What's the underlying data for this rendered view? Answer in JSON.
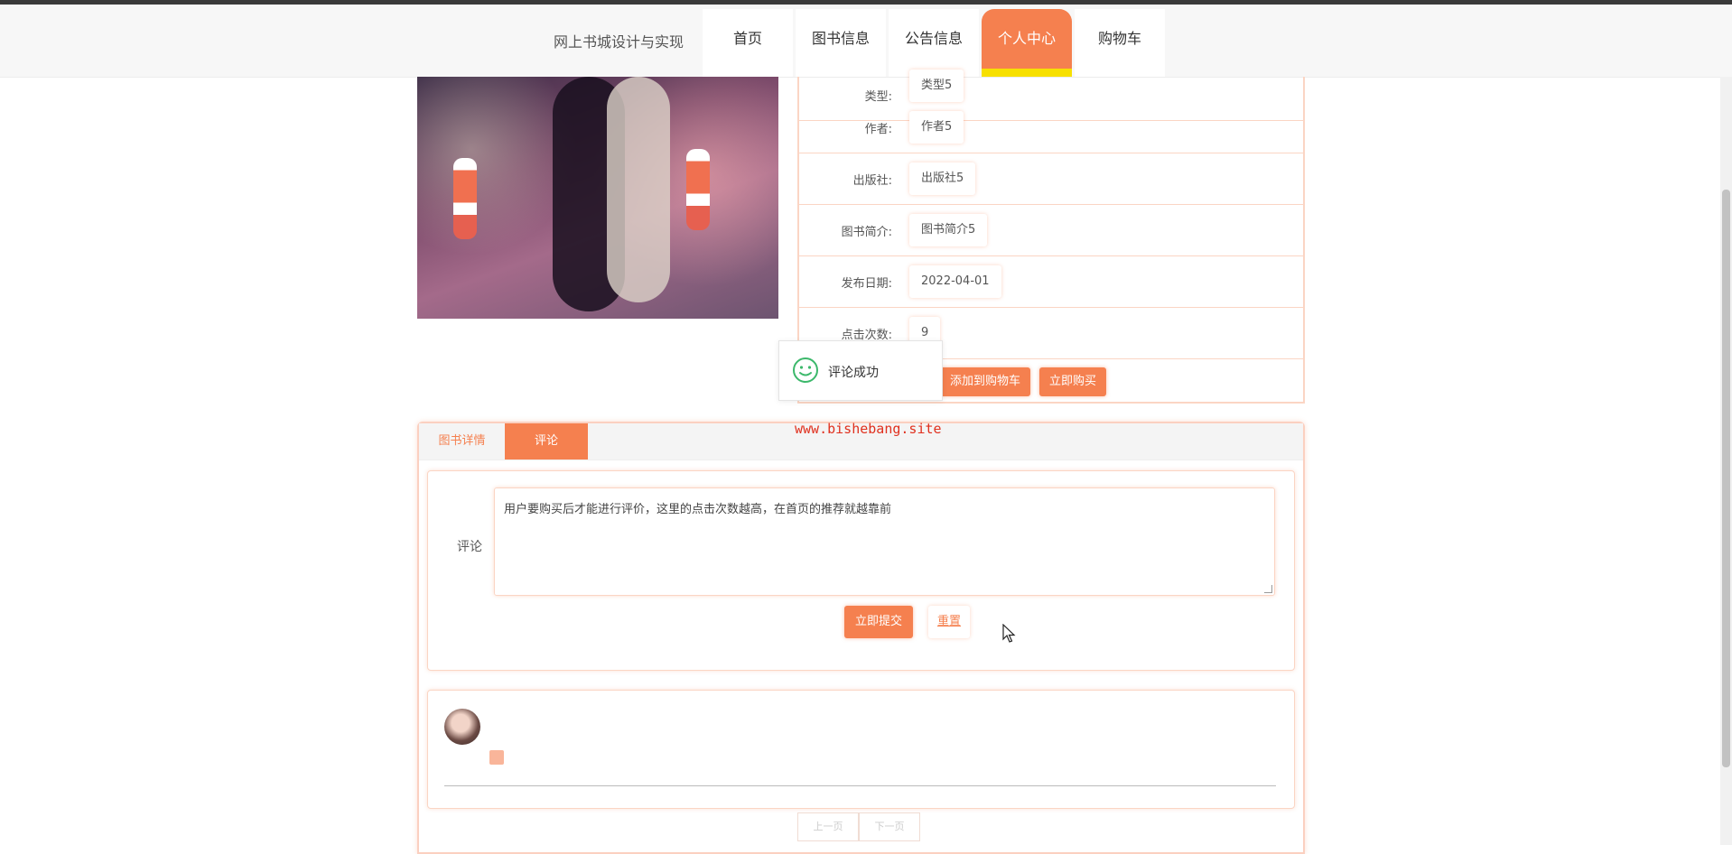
{
  "header": {
    "site_title": "网上书城设计与实现",
    "nav": [
      {
        "label": "首页"
      },
      {
        "label": "图书信息"
      },
      {
        "label": "公告信息"
      },
      {
        "label": "个人中心"
      },
      {
        "label": "购物车"
      }
    ],
    "active_nav": "个人中心"
  },
  "book_info": {
    "rows": [
      {
        "label": "类型:",
        "value": "类型5"
      },
      {
        "label": "作者:",
        "value": "作者5"
      },
      {
        "label": "出版社:",
        "value": "出版社5"
      },
      {
        "label": "图书简介:",
        "value": "图书简介5"
      },
      {
        "label": "发布日期:",
        "value": "2022-04-01"
      },
      {
        "label": "点击次数:",
        "value": "9"
      }
    ],
    "add_to_cart_label": "添加到购物车",
    "buy_now_label": "立即购买"
  },
  "toast": {
    "message": "评论成功",
    "icon": "smile-icon"
  },
  "watermark": "www.bishebang.site",
  "tabs": [
    {
      "label": "图书详情"
    },
    {
      "label": "评论"
    }
  ],
  "comment_form": {
    "label": "评论",
    "value": "用户要购买后才能进行评价，这里的点击次数越高，在首页的推荐就越靠前",
    "submit_label": "立即提交",
    "reset_label": "重置"
  },
  "pagination": {
    "prev_label": "上一页",
    "next_label": "下一页"
  },
  "colors": {
    "accent": "#f5804f",
    "highlight": "#f7e000"
  }
}
